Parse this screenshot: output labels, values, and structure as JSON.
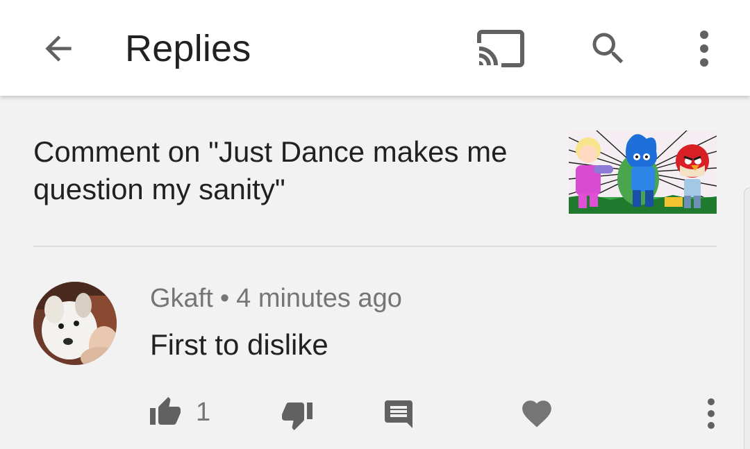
{
  "appbar": {
    "title": "Replies",
    "icons": [
      "back-arrow-icon",
      "cast-icon",
      "search-icon",
      "more-vert-icon"
    ]
  },
  "video": {
    "comment_on": "Comment on \"Just Dance makes me question my sanity\""
  },
  "comment": {
    "author": "Gkaft",
    "separator": "•",
    "time": "4 minutes ago",
    "text": "First to dislike",
    "likes": "1"
  },
  "colors": {
    "appbar_bg": "#ffffff",
    "page_bg": "#f2f2f2",
    "icon": "#616161",
    "secondary_text": "#757575"
  }
}
